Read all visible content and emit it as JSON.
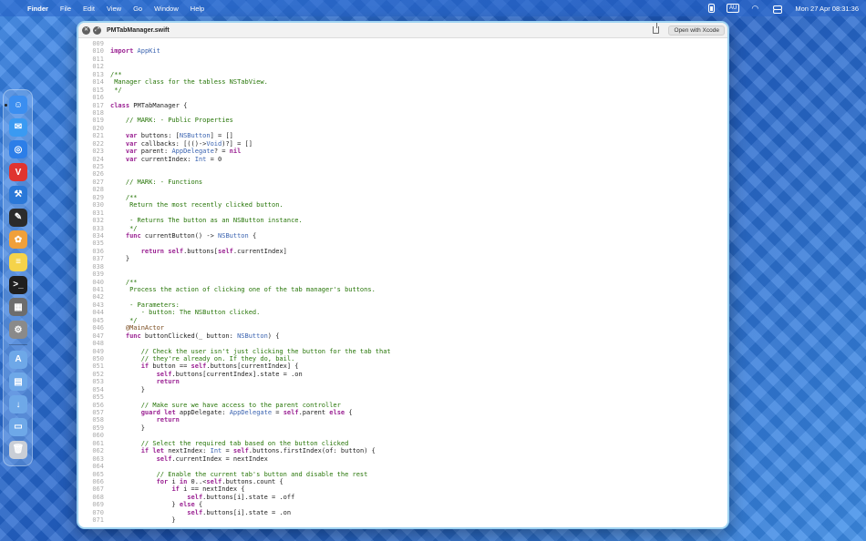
{
  "menubar": {
    "app_name": "Finder",
    "items": [
      "File",
      "Edit",
      "View",
      "Go",
      "Window",
      "Help"
    ],
    "keyboard_layout": "AU",
    "datetime": "Mon 27 Apr  08:31:36"
  },
  "dock": {
    "apps": [
      {
        "name": "finder-icon",
        "color": "#3b8ef0",
        "glyph": "☺"
      },
      {
        "name": "mail-icon",
        "color": "#3a9af2",
        "glyph": "✉"
      },
      {
        "name": "safari-icon",
        "color": "#2c7ee8",
        "glyph": "◎"
      },
      {
        "name": "vivaldi-icon",
        "color": "#e0342f",
        "glyph": "V"
      },
      {
        "name": "xcode-icon",
        "color": "#2a78d8",
        "glyph": "⚒"
      },
      {
        "name": "script-editor-icon",
        "color": "#2b2b2b",
        "glyph": "✎"
      },
      {
        "name": "pixelmator-icon",
        "color": "#f0a03a",
        "glyph": "✿"
      },
      {
        "name": "notes-icon",
        "color": "#f5d34a",
        "glyph": "≡"
      },
      {
        "name": "terminal-icon",
        "color": "#1f1f1f",
        "glyph": ">_"
      },
      {
        "name": "calculator-icon",
        "color": "#6d6d6d",
        "glyph": "▦"
      },
      {
        "name": "system-settings-icon",
        "color": "#8a8a8a",
        "glyph": "⚙"
      }
    ],
    "folders": [
      {
        "name": "applications-folder-icon",
        "color": "#6ea8e8",
        "glyph": "A"
      },
      {
        "name": "documents-folder-icon",
        "color": "#6ea8e8",
        "glyph": "▤"
      },
      {
        "name": "downloads-folder-icon",
        "color": "#6ea8e8",
        "glyph": "↓"
      },
      {
        "name": "desktop-folder-icon",
        "color": "#6ea8e8",
        "glyph": "▭"
      }
    ],
    "trash": {
      "name": "trash-icon",
      "color": "#c9ced6",
      "glyph": "🗑"
    }
  },
  "window": {
    "title": "PMTabManager.swift",
    "open_button": "Open with Xcode",
    "lines": [
      {
        "n": "009",
        "t": ""
      },
      {
        "n": "010",
        "t": "import AppKit"
      },
      {
        "n": "011",
        "t": ""
      },
      {
        "n": "012",
        "t": ""
      },
      {
        "n": "013",
        "t": "/**"
      },
      {
        "n": "014",
        "t": " Manager class for the tabless NSTabView."
      },
      {
        "n": "015",
        "t": " */"
      },
      {
        "n": "016",
        "t": ""
      },
      {
        "n": "017",
        "t": "class PMTabManager {"
      },
      {
        "n": "018",
        "t": ""
      },
      {
        "n": "019",
        "t": "    // MARK: - Public Properties"
      },
      {
        "n": "020",
        "t": ""
      },
      {
        "n": "021",
        "t": "    var buttons: [NSButton] = []"
      },
      {
        "n": "022",
        "t": "    var callbacks: [(()->Void)?] = []"
      },
      {
        "n": "023",
        "t": "    var parent: AppDelegate? = nil"
      },
      {
        "n": "024",
        "t": "    var currentIndex: Int = 0"
      },
      {
        "n": "025",
        "t": ""
      },
      {
        "n": "026",
        "t": ""
      },
      {
        "n": "027",
        "t": "    // MARK: - Functions"
      },
      {
        "n": "028",
        "t": ""
      },
      {
        "n": "029",
        "t": "    /**"
      },
      {
        "n": "030",
        "t": "     Return the most recently clicked button."
      },
      {
        "n": "031",
        "t": ""
      },
      {
        "n": "032",
        "t": "     - Returns The button as an NSButton instance."
      },
      {
        "n": "033",
        "t": "     */"
      },
      {
        "n": "034",
        "t": "    func currentButton() -> NSButton {"
      },
      {
        "n": "035",
        "t": ""
      },
      {
        "n": "036",
        "t": "        return self.buttons[self.currentIndex]"
      },
      {
        "n": "037",
        "t": "    }"
      },
      {
        "n": "038",
        "t": ""
      },
      {
        "n": "039",
        "t": ""
      },
      {
        "n": "040",
        "t": "    /**"
      },
      {
        "n": "041",
        "t": "     Process the action of clicking one of the tab manager's buttons."
      },
      {
        "n": "042",
        "t": ""
      },
      {
        "n": "043",
        "t": "     - Parameters:"
      },
      {
        "n": "044",
        "t": "        - button: The NSButton clicked."
      },
      {
        "n": "045",
        "t": "     */"
      },
      {
        "n": "046",
        "t": "    @MainActor"
      },
      {
        "n": "047",
        "t": "    func buttonClicked(_ button: NSButton) {"
      },
      {
        "n": "048",
        "t": ""
      },
      {
        "n": "049",
        "t": "        // Check the user isn't just clicking the button for the tab that"
      },
      {
        "n": "050",
        "t": "        // they're already on. If they do, bail."
      },
      {
        "n": "051",
        "t": "        if button == self.buttons[currentIndex] {"
      },
      {
        "n": "052",
        "t": "            self.buttons[currentIndex].state = .on"
      },
      {
        "n": "053",
        "t": "            return"
      },
      {
        "n": "054",
        "t": "        }"
      },
      {
        "n": "055",
        "t": ""
      },
      {
        "n": "056",
        "t": "        // Make sure we have access to the parent controller"
      },
      {
        "n": "057",
        "t": "        guard let appDelegate: AppDelegate = self.parent else {"
      },
      {
        "n": "058",
        "t": "            return"
      },
      {
        "n": "059",
        "t": "        }"
      },
      {
        "n": "060",
        "t": ""
      },
      {
        "n": "061",
        "t": "        // Select the required tab based on the button clicked"
      },
      {
        "n": "062",
        "t": "        if let nextIndex: Int = self.buttons.firstIndex(of: button) {"
      },
      {
        "n": "063",
        "t": "            self.currentIndex = nextIndex"
      },
      {
        "n": "064",
        "t": ""
      },
      {
        "n": "065",
        "t": "            // Enable the current tab's button and disable the rest"
      },
      {
        "n": "066",
        "t": "            for i in 0..<self.buttons.count {"
      },
      {
        "n": "067",
        "t": "                if i == nextIndex {"
      },
      {
        "n": "068",
        "t": "                    self.buttons[i].state = .off"
      },
      {
        "n": "069",
        "t": "                } else {"
      },
      {
        "n": "070",
        "t": "                    self.buttons[i].state = .on"
      },
      {
        "n": "071",
        "t": "                }"
      }
    ]
  }
}
